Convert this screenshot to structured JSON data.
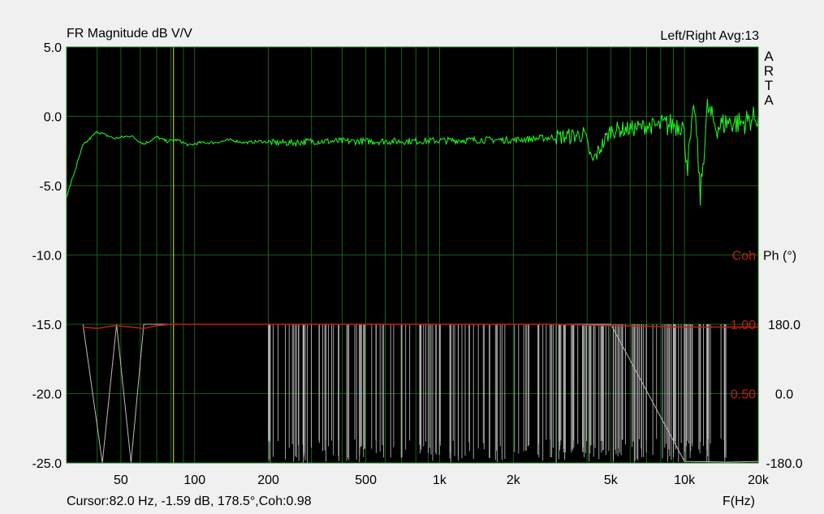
{
  "window": {
    "title": "FR Magnitude dB V/V",
    "measurement": "Left/Right  Avg:13",
    "brand_letters": [
      "A",
      "R",
      "T",
      "A"
    ],
    "cursor_readout": "Cursor:82.0 Hz, -1.59 dB, 178.5°,Coh:0.98",
    "x_unit_label": "F(Hz)",
    "colors": {
      "background": "#000000",
      "grid": "#1e7a1e",
      "magnitude": "#22ff22",
      "coherence": "#c02010",
      "phase": "#bdbdbd",
      "cursor": "#e8e800"
    }
  },
  "chart_data": {
    "type": "line",
    "title": "FR Magnitude dB V/V",
    "xlabel": "F(Hz)",
    "x_scale": "log",
    "xlim": [
      30,
      20000
    ],
    "x_ticks": [
      50,
      100,
      200,
      500,
      1000,
      2000,
      5000,
      10000,
      20000
    ],
    "x_tick_labels": [
      "50",
      "100",
      "200",
      "500",
      "1k",
      "2k",
      "5k",
      "10k",
      "20k"
    ],
    "y_left": {
      "ylim": [
        -25,
        5
      ],
      "ticks": [
        5,
        0,
        -5,
        -10,
        -15,
        -20,
        -25
      ],
      "tick_labels": [
        "5.0",
        "0.0",
        "-5.0",
        "-10.0",
        "-15.0",
        "-20.0",
        "-25.0"
      ]
    },
    "y_phase": {
      "label": "Ph (°)",
      "ylim": [
        -180,
        180
      ],
      "ticks": [
        180,
        0,
        -180
      ],
      "tick_labels": [
        "180.0",
        "0.0",
        "-180.0"
      ]
    },
    "y_coherence": {
      "label": "Coh",
      "ylim": [
        0,
        1
      ],
      "ticks": [
        1,
        0.5
      ],
      "tick_labels": [
        "1.00",
        "0.50"
      ]
    },
    "grid": true,
    "cursor_x": 82,
    "series": [
      {
        "axis": "left",
        "x": [
          30,
          35,
          40,
          47,
          55,
          62,
          70,
          77,
          85,
          95,
          105,
          120,
          140,
          160,
          185,
          210,
          250,
          300,
          400,
          500,
          700,
          1000,
          1500,
          2000,
          2500,
          3000,
          3500,
          3900,
          4200,
          5000,
          6000,
          7000,
          8000,
          9000,
          9800,
          10300,
          11000,
          11600,
          12400,
          13500,
          15000,
          17000,
          20000
        ],
        "values": [
          -5.8,
          -2.1,
          -1.1,
          -1.6,
          -1.4,
          -2.0,
          -1.5,
          -1.8,
          -1.7,
          -2.1,
          -1.9,
          -1.9,
          -1.7,
          -1.9,
          -1.8,
          -1.9,
          -1.9,
          -1.8,
          -1.8,
          -1.8,
          -1.8,
          -1.75,
          -1.7,
          -1.7,
          -1.6,
          -1.5,
          -1.4,
          -1.3,
          -3.3,
          -1.0,
          -0.9,
          -0.7,
          -0.7,
          -0.6,
          -0.5,
          -3.5,
          0.8,
          -5.8,
          0.6,
          -0.8,
          -0.4,
          -0.5,
          0.0
        ]
      },
      {
        "axis": "coherence",
        "x": [
          35,
          40,
          47,
          55,
          62,
          70,
          80,
          100,
          150,
          200,
          500,
          1000,
          2000,
          3000,
          5000,
          10000,
          15000,
          20000
        ],
        "values": [
          0.98,
          0.97,
          0.99,
          0.98,
          0.97,
          0.99,
          1.0,
          1.0,
          1.0,
          1.0,
          1.0,
          1.0,
          1.0,
          1.0,
          0.99,
          0.98,
          0.98,
          0.98
        ]
      },
      {
        "axis": "phase",
        "x": [
          35,
          42,
          48,
          55,
          62,
          70,
          80,
          150,
          260,
          400,
          1000,
          2000,
          5000,
          10000,
          15000,
          20000
        ],
        "values": [
          180,
          -180,
          180,
          -180,
          180,
          180,
          180,
          180,
          180,
          180,
          180,
          180,
          180,
          -176,
          -178,
          -176
        ]
      }
    ]
  }
}
